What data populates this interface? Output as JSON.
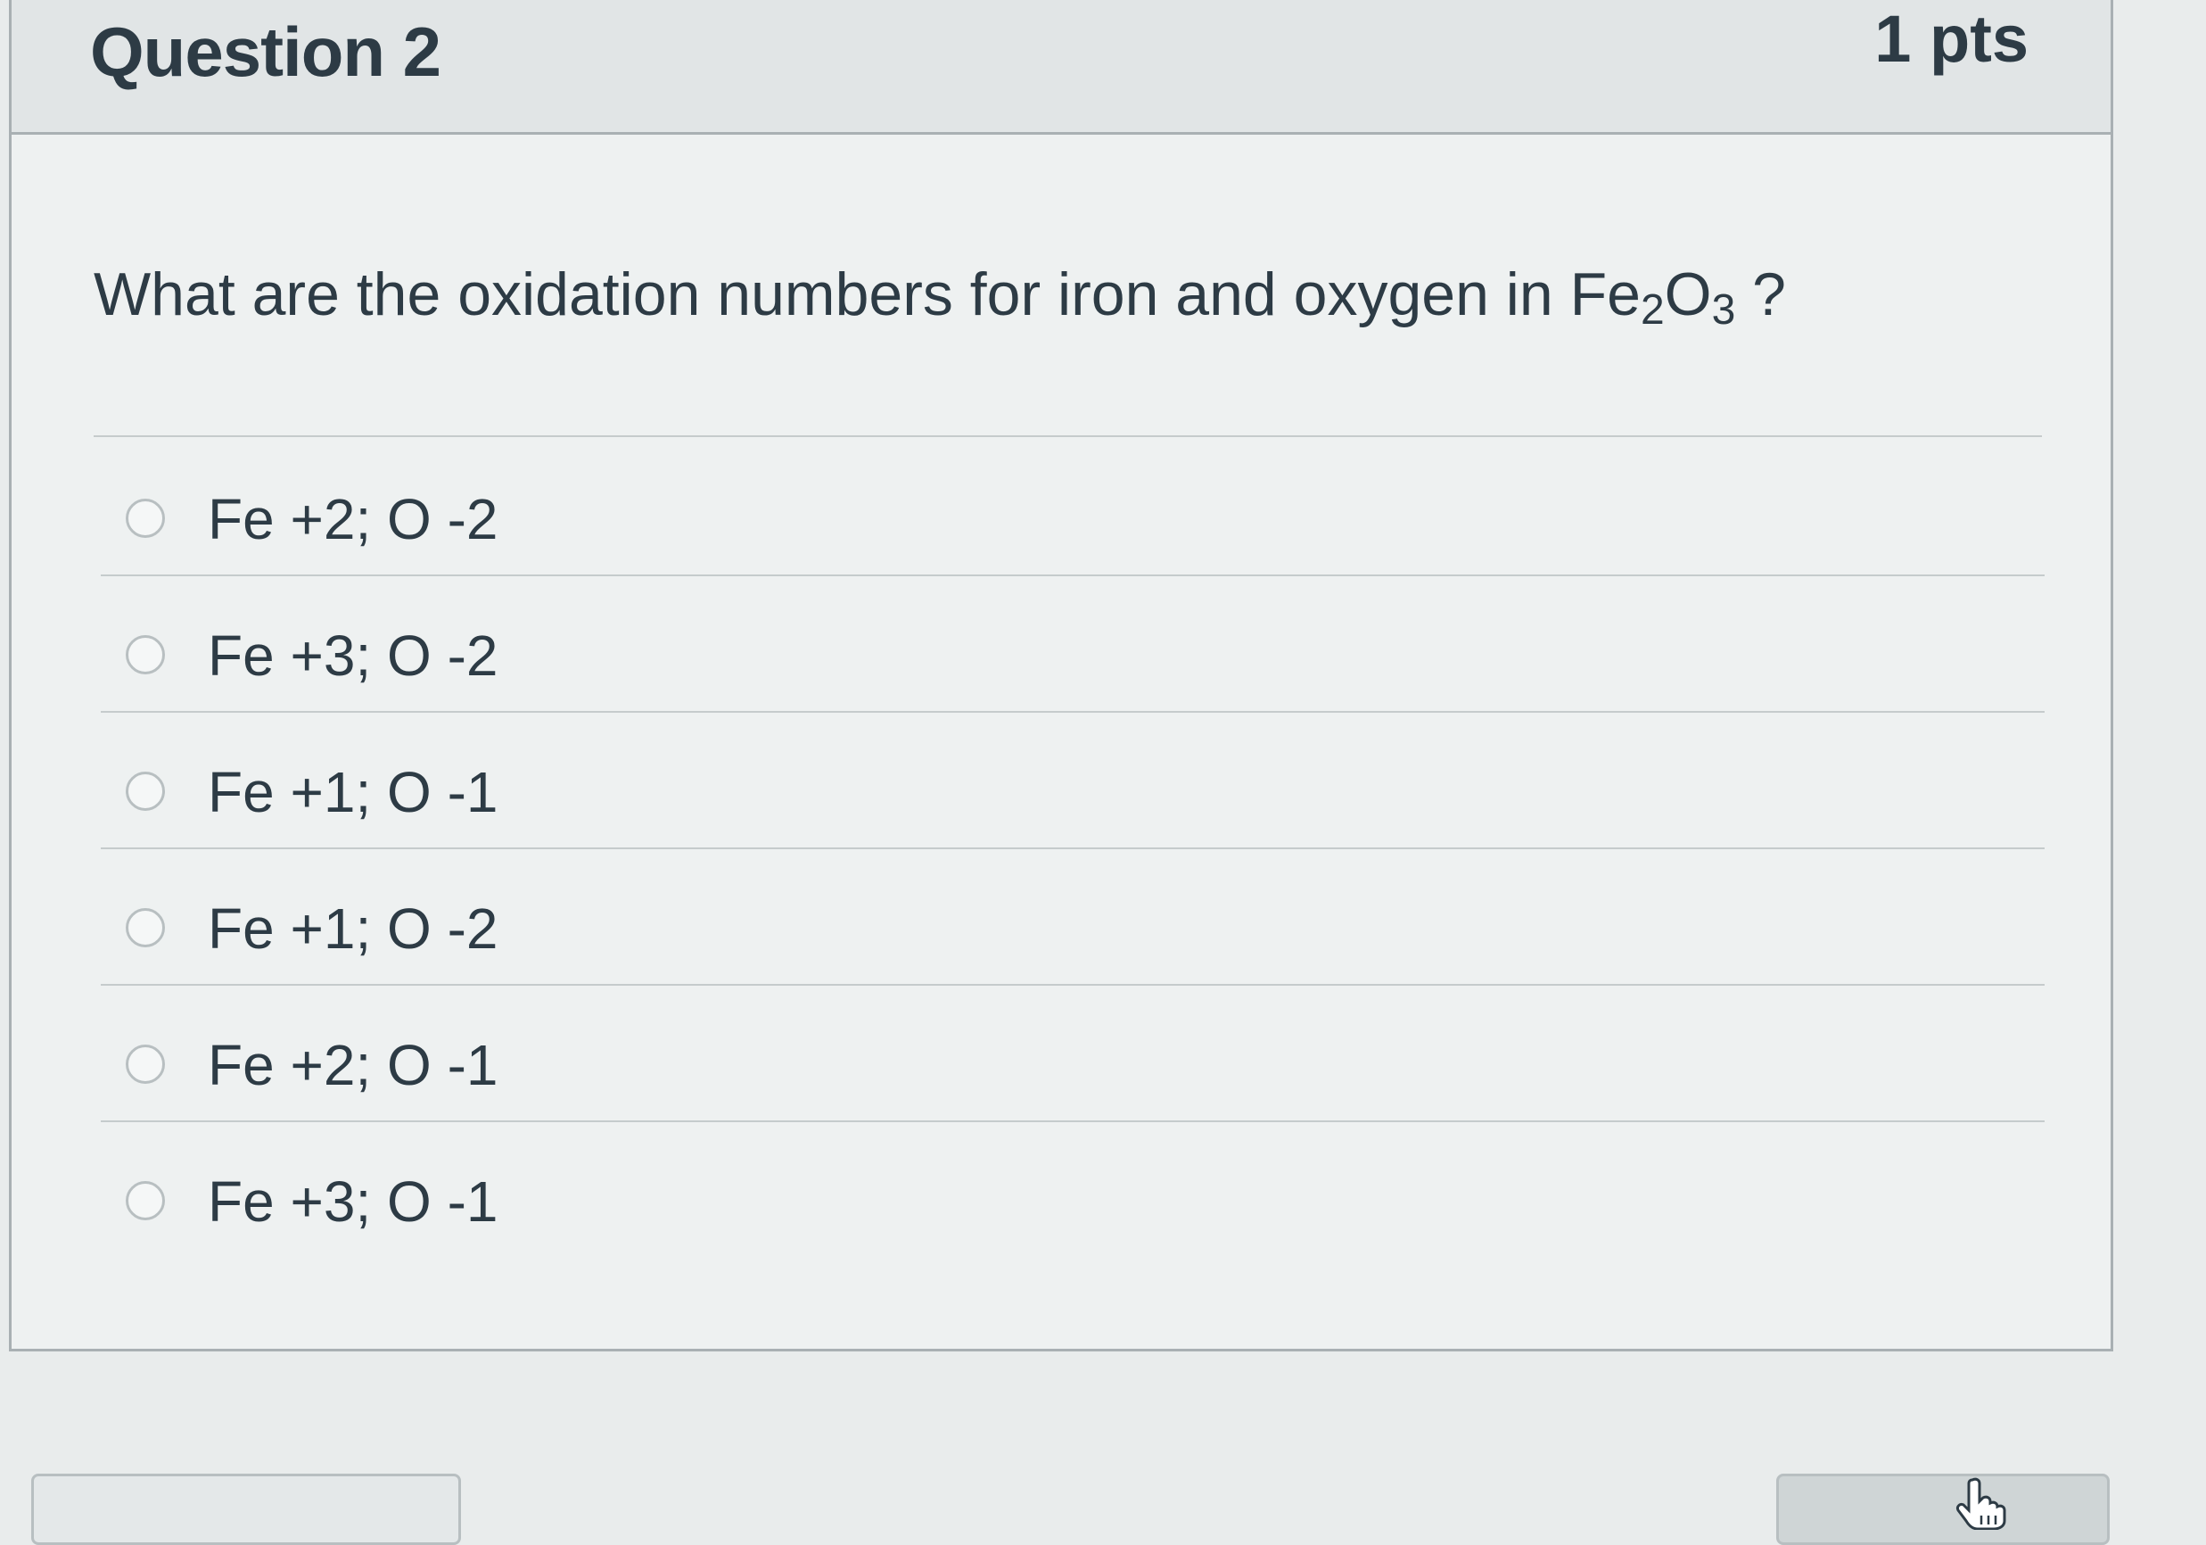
{
  "question": {
    "title": "Question 2",
    "points": "1 pts",
    "text_prefix": "What are the oxidation numbers for iron and oxygen in Fe",
    "sub1": "2",
    "text_mid": "O",
    "sub2": "3",
    "text_suffix": " ?"
  },
  "answers": [
    {
      "label": "Fe +2; O -2"
    },
    {
      "label": "Fe +3; O -2"
    },
    {
      "label": "Fe +1; O -1"
    },
    {
      "label": "Fe +1; O -2"
    },
    {
      "label": "Fe +2; O -1"
    },
    {
      "label": "Fe +3; O -1"
    }
  ],
  "cursor": {
    "icon": "hand-pointer-icon"
  }
}
